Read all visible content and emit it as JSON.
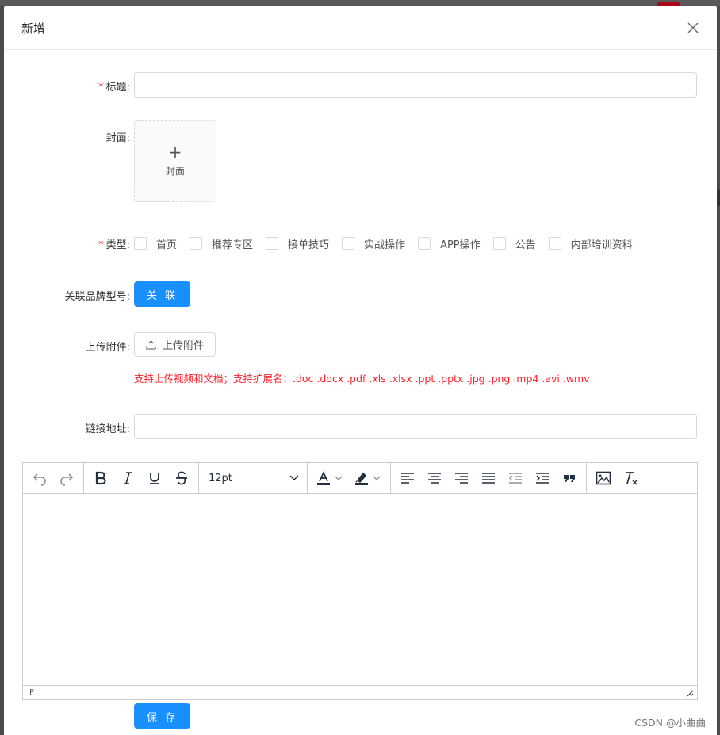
{
  "dialog": {
    "title": "新增"
  },
  "form": {
    "title_field": {
      "label": "标题:",
      "required_mark": "*",
      "value": "",
      "placeholder": ""
    },
    "cover_field": {
      "label": "封面:",
      "upload_text": "封面"
    },
    "type_field": {
      "label": "类型:",
      "required_mark": "*",
      "options": [
        "首页",
        "推荐专区",
        "接单技巧",
        "实战操作",
        "APP操作",
        "公告",
        "内部培训资料"
      ]
    },
    "brand_field": {
      "label": "关联品牌型号:",
      "button_label": "关 联"
    },
    "attachment_field": {
      "label": "上传附件:",
      "button_label": "上传附件",
      "hint": "支持上传视频和文档；支持扩展名：.doc .docx .pdf .xls .xlsx .ppt .pptx .jpg .png .mp4 .avi .wmv"
    },
    "link_field": {
      "label": "链接地址:",
      "value": "",
      "placeholder": ""
    }
  },
  "editor": {
    "font_size": "12pt",
    "status_path": "P",
    "content": ""
  },
  "actions": {
    "save_label": "保 存"
  },
  "watermark": "CSDN @小曲曲",
  "colors": {
    "primary": "#1890ff",
    "danger": "#f5222d",
    "border": "#d9d9d9"
  }
}
